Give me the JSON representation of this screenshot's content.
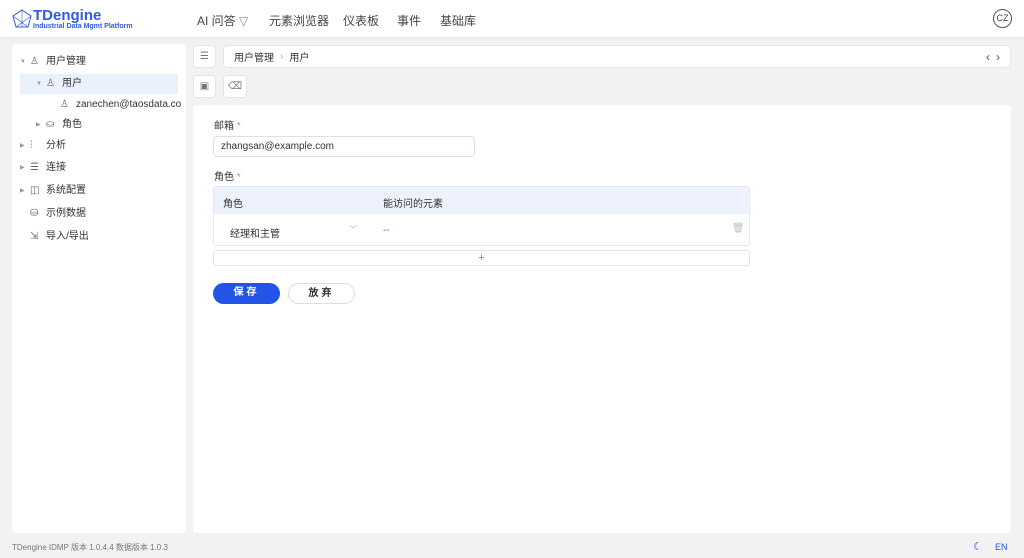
{
  "header": {
    "logo_title": "TDengine",
    "logo_subtitle": "Industrial Data Mgmt Platform",
    "nav": [
      {
        "label": "AI 问答"
      },
      {
        "label": "元素浏览器"
      },
      {
        "label": "仪表板"
      },
      {
        "label": "事件"
      },
      {
        "label": "基础库"
      }
    ],
    "avatar": "CZ"
  },
  "sidebar": {
    "items": [
      {
        "label": "用户管理",
        "icon": "users-icon"
      },
      {
        "label": "用户",
        "icon": "user-icon"
      },
      {
        "label": "zanechen@taosdata.co",
        "icon": "person-icon"
      },
      {
        "label": "角色",
        "icon": "role-icon"
      },
      {
        "label": "分析",
        "icon": "chart-icon"
      },
      {
        "label": "连接",
        "icon": "connection-icon"
      },
      {
        "label": "系统配置",
        "icon": "settings-icon"
      },
      {
        "label": "示例数据",
        "icon": "database-icon"
      },
      {
        "label": "导入/导出",
        "icon": "import-export-icon"
      }
    ]
  },
  "breadcrumb": [
    "用户管理",
    "用户"
  ],
  "form": {
    "email_label": "邮箱",
    "required": "*",
    "email_value": "zhangsan@example.com",
    "role_label": "角色",
    "table": {
      "headers": [
        "角色",
        "能访问的元素"
      ],
      "rows": [
        {
          "role": "经理和主管",
          "elements": "--"
        }
      ]
    },
    "add": "+",
    "save": "保存",
    "discard": "放弃"
  },
  "footer": {
    "version": "TDengine IDMP 版本 1.0.4.4 数据版本 1.0.3",
    "lang": "EN"
  },
  "colors": {
    "accent": "#2453e8"
  }
}
